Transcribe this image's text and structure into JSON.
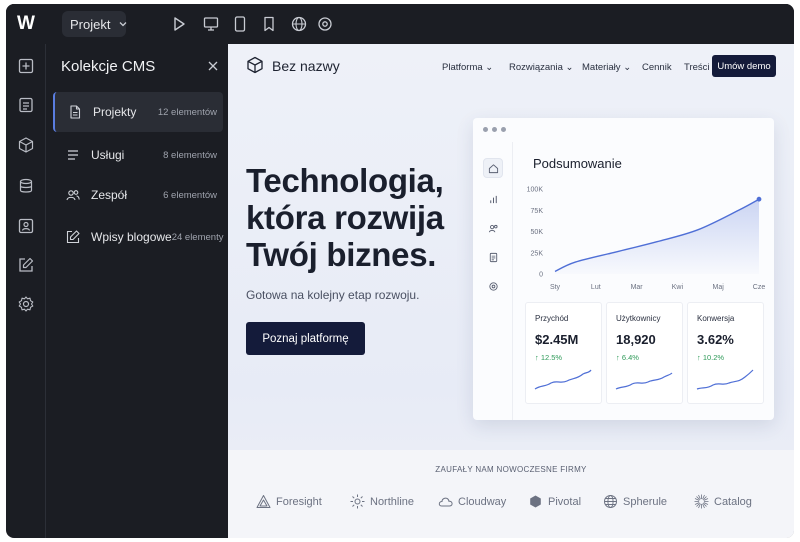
{
  "app": {
    "logo": "W",
    "project_label": "Projekt",
    "toolbar_icons": [
      "play-icon",
      "desktop-icon",
      "tablet-icon",
      "mobile-icon",
      "globe-icon",
      "settings-icon"
    ]
  },
  "rail": {
    "icons": [
      "add-icon",
      "pages-icon",
      "components-icon",
      "cms-database-icon",
      "assets-icon",
      "edit-icon",
      "settings-icon"
    ]
  },
  "cms": {
    "title": "Kolekcje CMS",
    "items": [
      {
        "label": "Projekty",
        "count": "12 elementów",
        "icon": "document-icon"
      },
      {
        "label": "Usługi",
        "count": "8 elementów",
        "icon": "list-icon"
      },
      {
        "label": "Zespół",
        "count": "6 elementów",
        "icon": "team-icon"
      },
      {
        "label": "Wpisy blogowe",
        "count": "24 elementy",
        "icon": "pencil-icon"
      }
    ]
  },
  "site": {
    "brand": "Bez nazwy",
    "nav": [
      "Platforma",
      "Rozwiązania",
      "Materiały",
      "Cennik",
      "Treści"
    ],
    "cta": "Umów demo",
    "hero": {
      "title_lines": [
        "Technologia,",
        "która rozwija",
        "Twój biznes."
      ],
      "subtitle": "Gotowa na kolejny etap rozwoju.",
      "button": "Poznaj platformę"
    },
    "dashboard": {
      "title": "Podsumowanie",
      "kpis": [
        {
          "label": "Przychód",
          "value": "$2.45M",
          "delta": "↑ 12.5%"
        },
        {
          "label": "Użytkownicy",
          "value": "18,920",
          "delta": "↑ 6.4%"
        },
        {
          "label": "Konwersja",
          "value": "3.62%",
          "delta": "↑ 10.2%"
        }
      ]
    },
    "logos": {
      "title": "ZAUFAŁY NAM NOWOCZESNE FIRMY",
      "items": [
        "Foresight",
        "Northline",
        "Cloudway",
        "Pivotal",
        "Spherule",
        "Catalog"
      ]
    }
  },
  "chart_data": {
    "type": "area",
    "categories": [
      "Sty",
      "Lut",
      "Mar",
      "Kwi",
      "Maj",
      "Cze"
    ],
    "values": [
      3,
      14,
      26,
      38,
      52,
      75,
      88
    ],
    "x_points": [
      0,
      0.5,
      1.5,
      2.5,
      3.5,
      4.5,
      5.0
    ],
    "y_ticks": [
      "100K",
      "75K",
      "50K",
      "25K",
      "0"
    ],
    "ylim": [
      0,
      100
    ],
    "color": "#4f6fd6"
  },
  "colors": {
    "accent": "#141b3a",
    "chart_line": "#4f6fd6",
    "positive": "#2e9a58"
  }
}
